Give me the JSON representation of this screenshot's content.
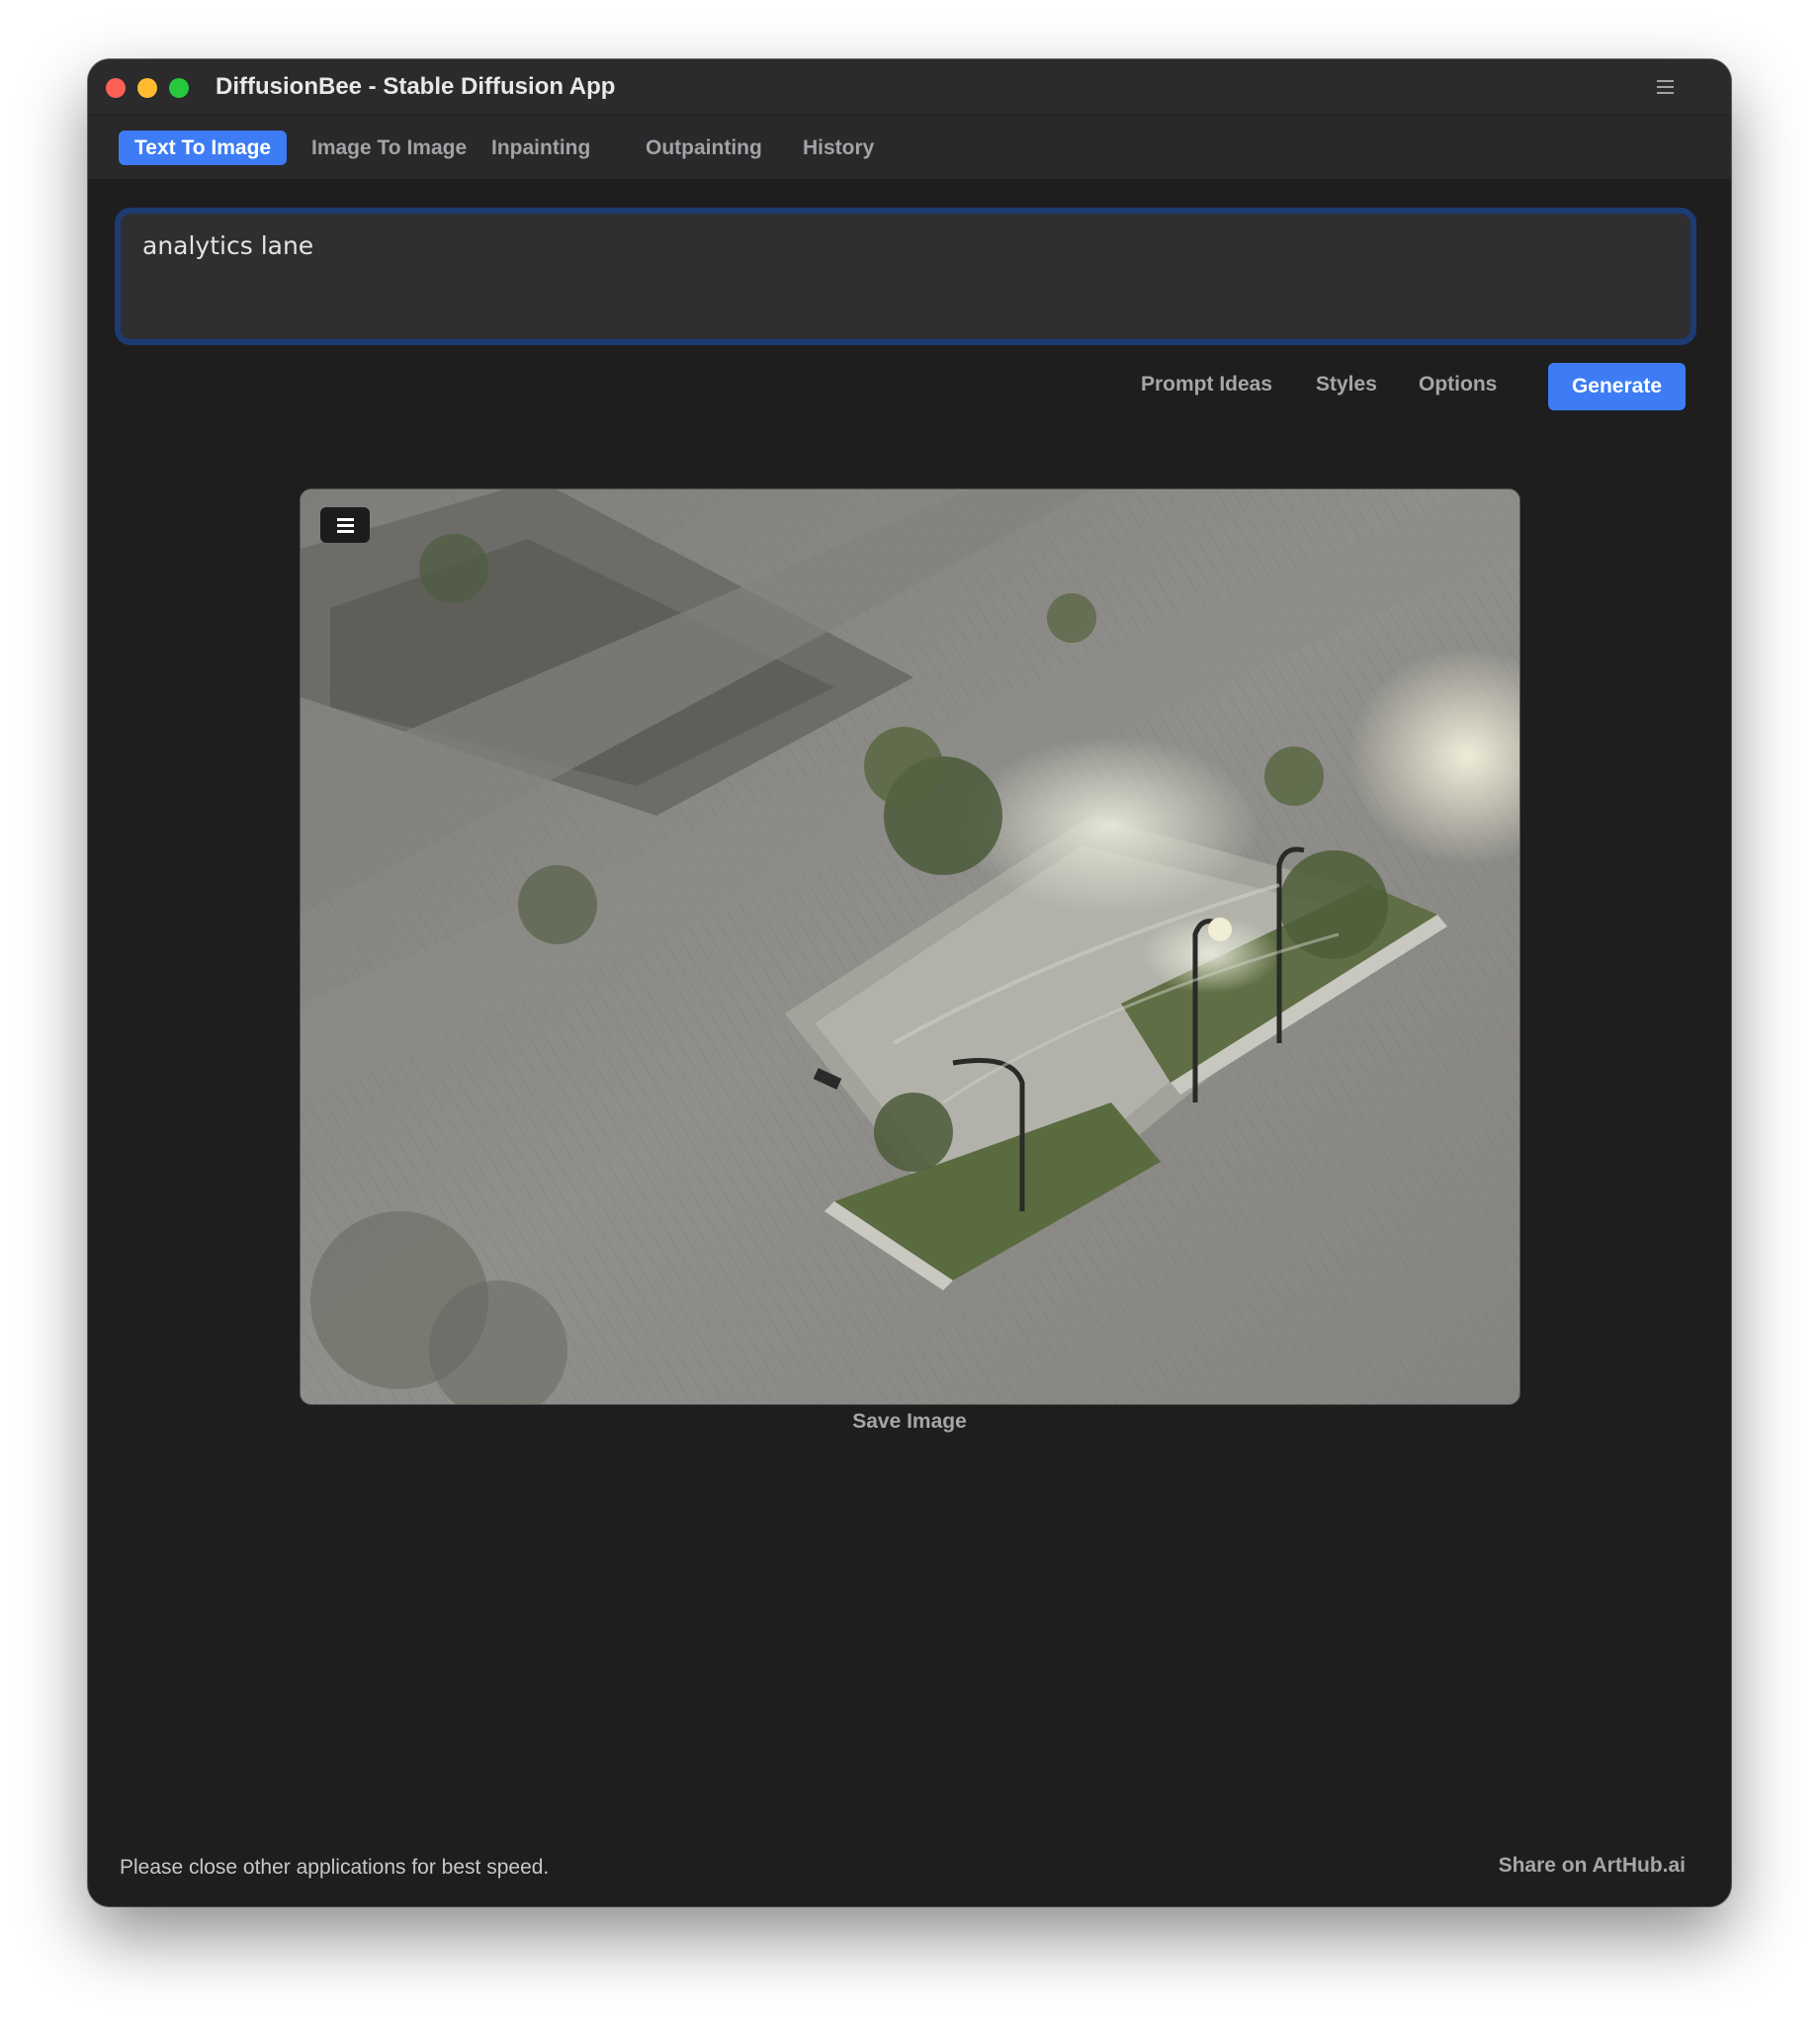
{
  "window": {
    "title": "DiffusionBee - Stable Diffusion App"
  },
  "tabs": [
    {
      "label": "Text To Image",
      "active": true
    },
    {
      "label": "Image To Image",
      "active": false
    },
    {
      "label": "Inpainting",
      "active": false
    },
    {
      "label": "Outpainting",
      "active": false
    },
    {
      "label": "History",
      "active": false
    }
  ],
  "prompt": {
    "value": "analytics lane"
  },
  "actions": {
    "prompt_ideas": "Prompt Ideas",
    "styles": "Styles",
    "options": "Options",
    "generate": "Generate"
  },
  "result": {
    "image_icon": "menu-icon",
    "save_label": "Save Image"
  },
  "footer": {
    "status": "Please close other applications for best speed.",
    "share": "Share on ArtHub.ai"
  },
  "colors": {
    "accent": "#3d7cf5",
    "window_bg": "#1e1e1f",
    "prompt_border": "#1d3b73"
  }
}
